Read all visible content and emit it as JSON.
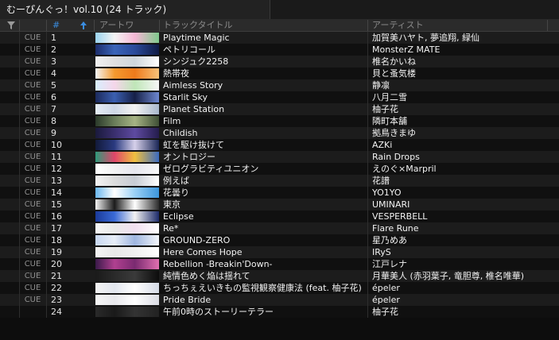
{
  "window": {
    "tab_title": "むーぴんぐっ！vol.10 (24 トラック)"
  },
  "header": {
    "num_label": "#",
    "art_label": "アートワ",
    "title_label": "トラックタイトル",
    "artist_label": "アーティスト"
  },
  "icons": {
    "filter": "filter-icon",
    "sort": "sort-up-arrow-icon"
  },
  "colors": {
    "accent_blue": "#3a8de0",
    "row_odd": "#1c1c1c",
    "row_even": "#101010"
  },
  "tracks": [
    {
      "cue": "CUE",
      "num": "1",
      "title": "Playtime Magic",
      "artist": "加賀美ハヤト, 夢追翔, 緑仙",
      "art": [
        "#9ad4ef",
        "#f4f4f4",
        "#f6b8d6",
        "#7ec98c"
      ]
    },
    {
      "cue": "CUE",
      "num": "2",
      "title": "ペトリコール",
      "artist": "MonsterZ MATE",
      "art": [
        "#1c2d6b",
        "#3a64b8",
        "#2a4a9a",
        "#0f1a44"
      ]
    },
    {
      "cue": "CUE",
      "num": "3",
      "title": "シンジュク2258",
      "artist": "椎名かいね",
      "art": [
        "#f2f2f2",
        "#e0e0e0",
        "#cfd6dc",
        "#ffffff"
      ]
    },
    {
      "cue": "CUE",
      "num": "4",
      "title": "熱帯夜",
      "artist": "貝と蚤気楼",
      "art": [
        "#f5f5f5",
        "#f39a2f",
        "#ee7a1c",
        "#f6c27a"
      ]
    },
    {
      "cue": "CUE",
      "num": "5",
      "title": "Aimless Story",
      "artist": "静凛",
      "art": [
        "#d8efff",
        "#f5d6ea",
        "#bfe6b8",
        "#f7f7f7"
      ]
    },
    {
      "cue": "CUE",
      "num": "6",
      "title": "Starlit Sky",
      "artist": "八月二雪",
      "art": [
        "#1b2a5c",
        "#3b5fb0",
        "#162048",
        "#6e88d0"
      ]
    },
    {
      "cue": "CUE",
      "num": "7",
      "title": "Planet Station",
      "artist": "柚子花",
      "art": [
        "#e6eef6",
        "#cfd8e6",
        "#f2f2f2",
        "#a9b8cc"
      ]
    },
    {
      "cue": "CUE",
      "num": "8",
      "title": "Film",
      "artist": "隣町本舗",
      "art": [
        "#2b3a2a",
        "#6a7d5a",
        "#a6b384",
        "#3f4f35"
      ]
    },
    {
      "cue": "CUE",
      "num": "9",
      "title": "Childish",
      "artist": "拠鳥きまゆ",
      "art": [
        "#1a1a3c",
        "#3a2f6e",
        "#5e4aa0",
        "#241c4c"
      ]
    },
    {
      "cue": "CUE",
      "num": "10",
      "title": "虹を駆け抜けて",
      "artist": "AZKi",
      "art": [
        "#121a3a",
        "#2a3a80",
        "#d6d0ea",
        "#1a2656"
      ]
    },
    {
      "cue": "CUE",
      "num": "11",
      "title": "オントロジー",
      "artist": "Rain Drops",
      "art": [
        "#2d9a7a",
        "#e0466a",
        "#f0c040",
        "#3a6ac0"
      ]
    },
    {
      "cue": "CUE",
      "num": "12",
      "title": "ゼログラビティユニオン",
      "artist": "えのぐ×Marpril",
      "art": [
        "#ffffff",
        "#f2f2f2",
        "#e6e6ee",
        "#f8f8f8"
      ]
    },
    {
      "cue": "CUE",
      "num": "13",
      "title": "例えば",
      "artist": "花譜",
      "art": [
        "#f4f4f4",
        "#dcdcdc",
        "#c8ccd4",
        "#ffffff"
      ]
    },
    {
      "cue": "CUE",
      "num": "14",
      "title": "花曇り",
      "artist": "YO1YO",
      "art": [
        "#6ab8f0",
        "#ffffff",
        "#9ad0f6",
        "#3c96dc"
      ]
    },
    {
      "cue": "CUE",
      "num": "15",
      "title": "東京",
      "artist": "UMINARI",
      "art": [
        "#f4f4f4",
        "#1c1c1c",
        "#ffffff",
        "#2c2c2c"
      ]
    },
    {
      "cue": "CUE",
      "num": "16",
      "title": "Eclipse",
      "artist": "VESPERBELL",
      "art": [
        "#1a3a9a",
        "#3a6ad6",
        "#f2f2f2",
        "#1c2a6a"
      ]
    },
    {
      "cue": "CUE",
      "num": "17",
      "title": "Re*",
      "artist": "Flare Rune",
      "art": [
        "#f7f7f7",
        "#eaeaea",
        "#f2e0f0",
        "#ffffff"
      ]
    },
    {
      "cue": "CUE",
      "num": "18",
      "title": "GROUND-ZERO",
      "artist": "星乃めあ",
      "art": [
        "#c8d8f2",
        "#e8eef8",
        "#9fb6e0",
        "#f4f6fb"
      ]
    },
    {
      "cue": "CUE",
      "num": "19",
      "title": "Here Comes Hope",
      "artist": "IRyS",
      "art": [
        "#f5f5f5",
        "#e8e8e8",
        "#f0f0f0",
        "#ffffff"
      ]
    },
    {
      "cue": "CUE",
      "num": "20",
      "title": "Rebellion -Breakin'Down-",
      "artist": "江戸レナ",
      "art": [
        "#3a1a4a",
        "#b04090",
        "#7a2a70",
        "#e070b0"
      ]
    },
    {
      "cue": "CUE",
      "num": "21",
      "title": "純情色めく焔は揺れて",
      "artist": "月華美人 (赤羽葉子, 竜胆尊, 椎名唯華)",
      "art": [
        "#1a1a1a",
        "#2a2a2a",
        "#3a3a3a",
        "#0c0c0c"
      ]
    },
    {
      "cue": "CUE",
      "num": "22",
      "title": "ちっちぇえいきもの監視観察健康法 (feat. 柚子花)",
      "artist": "épeler",
      "art": [
        "#f4f4f4",
        "#e2e6ee",
        "#ffffff",
        "#d4dae6"
      ]
    },
    {
      "cue": "CUE",
      "num": "23",
      "title": "Pride Bride",
      "artist": "épeler",
      "art": [
        "#f6f6f6",
        "#e8e8ec",
        "#ffffff",
        "#dadce4"
      ]
    },
    {
      "cue": "",
      "num": "24",
      "title": "午前0時のストーリーテラー",
      "artist": "柚子花",
      "art": [
        "#2a2a2a",
        "#1a1a1a",
        "#333333",
        "#222222"
      ]
    }
  ]
}
